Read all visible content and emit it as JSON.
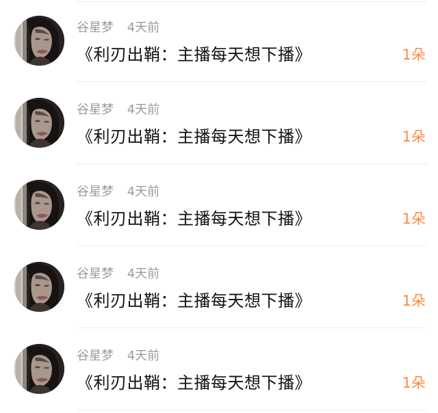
{
  "rows": [
    {
      "username": "谷星梦",
      "time": "4天前",
      "title": "《利刃出鞘：主播每天想下播》",
      "count": "1朵"
    },
    {
      "username": "谷星梦",
      "time": "4天前",
      "title": "《利刃出鞘：主播每天想下播》",
      "count": "1朵"
    },
    {
      "username": "谷星梦",
      "time": "4天前",
      "title": "《利刃出鞘：主播每天想下播》",
      "count": "1朵"
    },
    {
      "username": "谷星梦",
      "time": "4天前",
      "title": "《利刃出鞘：主播每天想下播》",
      "count": "1朵"
    },
    {
      "username": "谷星梦",
      "time": "4天前",
      "title": "《利刃出鞘：主播每天想下播》",
      "count": "1朵"
    }
  ],
  "icons": {
    "avatar": "user-avatar-photo"
  },
  "colors": {
    "username": "#9b9b9b",
    "title": "#111111",
    "count": "#ff8a3d",
    "divider": "#ededed"
  }
}
